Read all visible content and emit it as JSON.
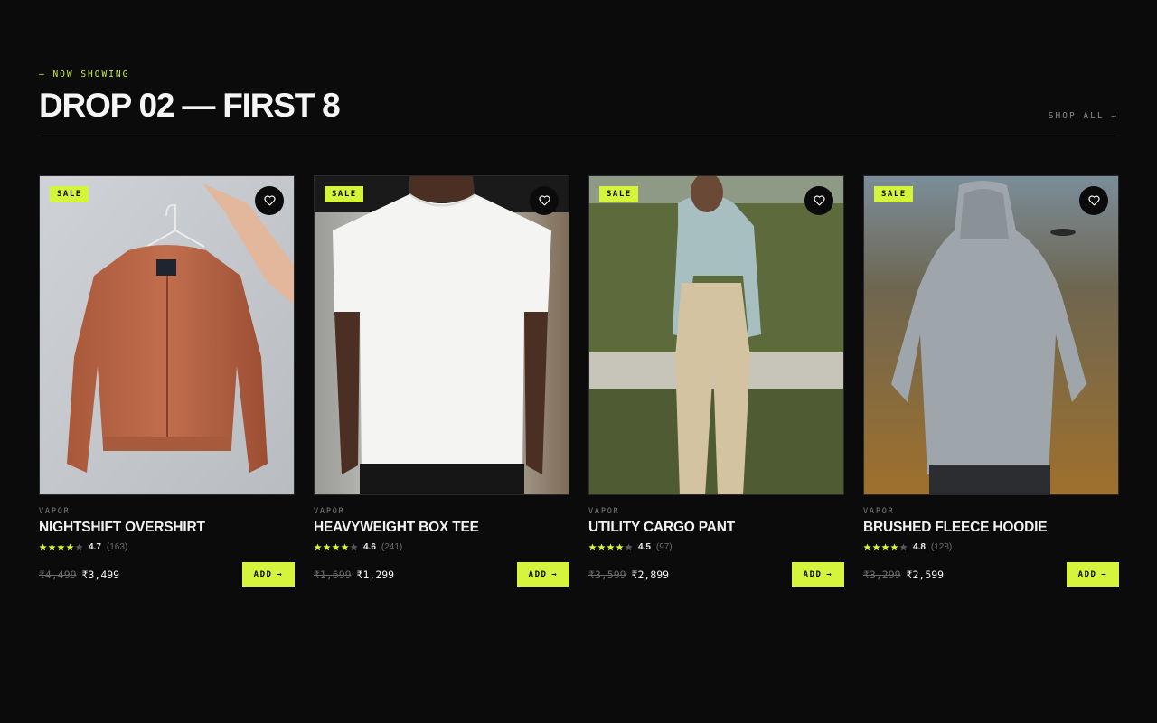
{
  "header": {
    "eyebrow": "— NOW SHOWING",
    "title": "DROP 02 — FIRST 8",
    "shop_all": "SHOP ALL →"
  },
  "colors": {
    "accent": "#d4f53c",
    "background": "#0b0b0c"
  },
  "products": [
    {
      "badge": "SALE",
      "brand": "VAPOR",
      "name": "NIGHTSHIFT OVERSHIRT",
      "rating": "4.7",
      "reviews": "(163)",
      "stars": 4,
      "old_price": "₹4,499",
      "price": "₹3,499",
      "add_label": "ADD",
      "add_icon": "→",
      "image": "rust-bomber-jacket-on-hanger"
    },
    {
      "badge": "SALE",
      "brand": "VAPOR",
      "name": "HEAVYWEIGHT BOX TEE",
      "rating": "4.6",
      "reviews": "(241)",
      "stars": 4,
      "old_price": "₹1,699",
      "price": "₹1,299",
      "add_label": "ADD",
      "add_icon": "→",
      "image": "white-tee-model"
    },
    {
      "badge": "SALE",
      "brand": "VAPOR",
      "name": "UTILITY CARGO PANT",
      "rating": "4.5",
      "reviews": "(97)",
      "stars": 4,
      "old_price": "₹3,599",
      "price": "₹2,899",
      "add_label": "ADD",
      "add_icon": "→",
      "image": "beige-trousers-model-hedge"
    },
    {
      "badge": "SALE",
      "brand": "VAPOR",
      "name": "BRUSHED FLEECE HOODIE",
      "rating": "4.8",
      "reviews": "(128)",
      "stars": 4,
      "old_price": "₹3,299",
      "price": "₹2,599",
      "add_label": "ADD",
      "add_icon": "→",
      "image": "grey-hoodie-back-view"
    }
  ]
}
